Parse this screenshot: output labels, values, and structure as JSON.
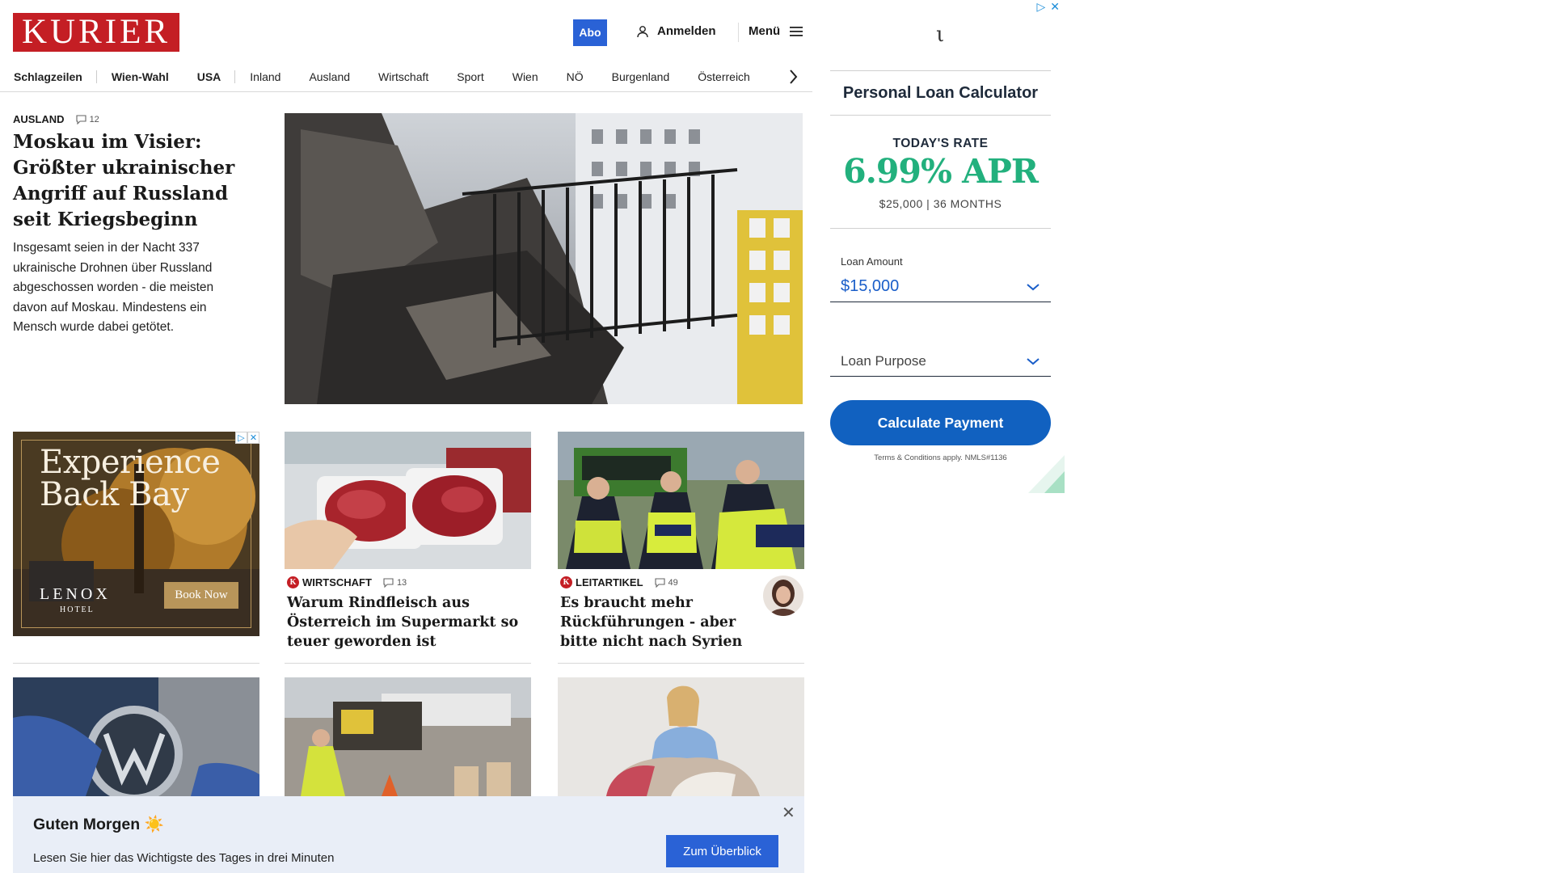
{
  "header": {
    "logo": "KURIER",
    "abo": "Abo",
    "login": "Anmelden",
    "menu": "Menü"
  },
  "nav": {
    "items": [
      "Schlagzeilen",
      "Wien-Wahl",
      "USA",
      "Inland",
      "Ausland",
      "Wirtschaft",
      "Sport",
      "Wien",
      "NÖ",
      "Burgenland",
      "Österreich"
    ]
  },
  "lead": {
    "category": "AUSLAND",
    "comments": "12",
    "title": "Moskau im Visier: Größter ukrainischer Angriff auf Russland seit Kriegsbeginn",
    "text": "Insgesamt seien in der Nacht 337 ukrainische Drohnen über Russland abgeschossen worden - die meisten davon auf Moskau. Mindestens ein Mensch wurde dabei getötet."
  },
  "ad_backbay": {
    "headline_1": "Experience",
    "headline_2": "Back Bay",
    "hotel": "LENOX",
    "hotel_sub": "HOTEL",
    "button": "Book Now"
  },
  "articles": [
    {
      "category": "WIRTSCHAFT",
      "comments": "13",
      "title": "Warum Rindfleisch aus Österreich im Supermarkt so teuer geworden ist"
    },
    {
      "category": "LEITARTIKEL",
      "comments": "49",
      "title": "Es braucht mehr Rückführungen - aber bitte nicht nach Syrien"
    }
  ],
  "ad_right": {
    "brand": "ι",
    "title": "Personal Loan Calculator",
    "rate_label": "TODAY'S RATE",
    "rate_value": "6.99% APR",
    "rate_sub": "$25,000 | 36 MONTHS",
    "loan_amount_label": "Loan Amount",
    "loan_amount_value": "$15,000",
    "loan_purpose_placeholder": "Loan Purpose",
    "button": "Calculate Payment",
    "terms": "Terms & Conditions apply. NMLS#1136"
  },
  "banner": {
    "title": "Guten Morgen ☀️",
    "text": "Lesen Sie hier das Wichtigste des Tages in drei Minuten",
    "button": "Zum Überblick"
  },
  "colors": {
    "brand_red": "#c41e24",
    "accent_blue": "#2a62d6",
    "rate_green": "#22b07d",
    "banner_bg": "#e9eef7"
  }
}
